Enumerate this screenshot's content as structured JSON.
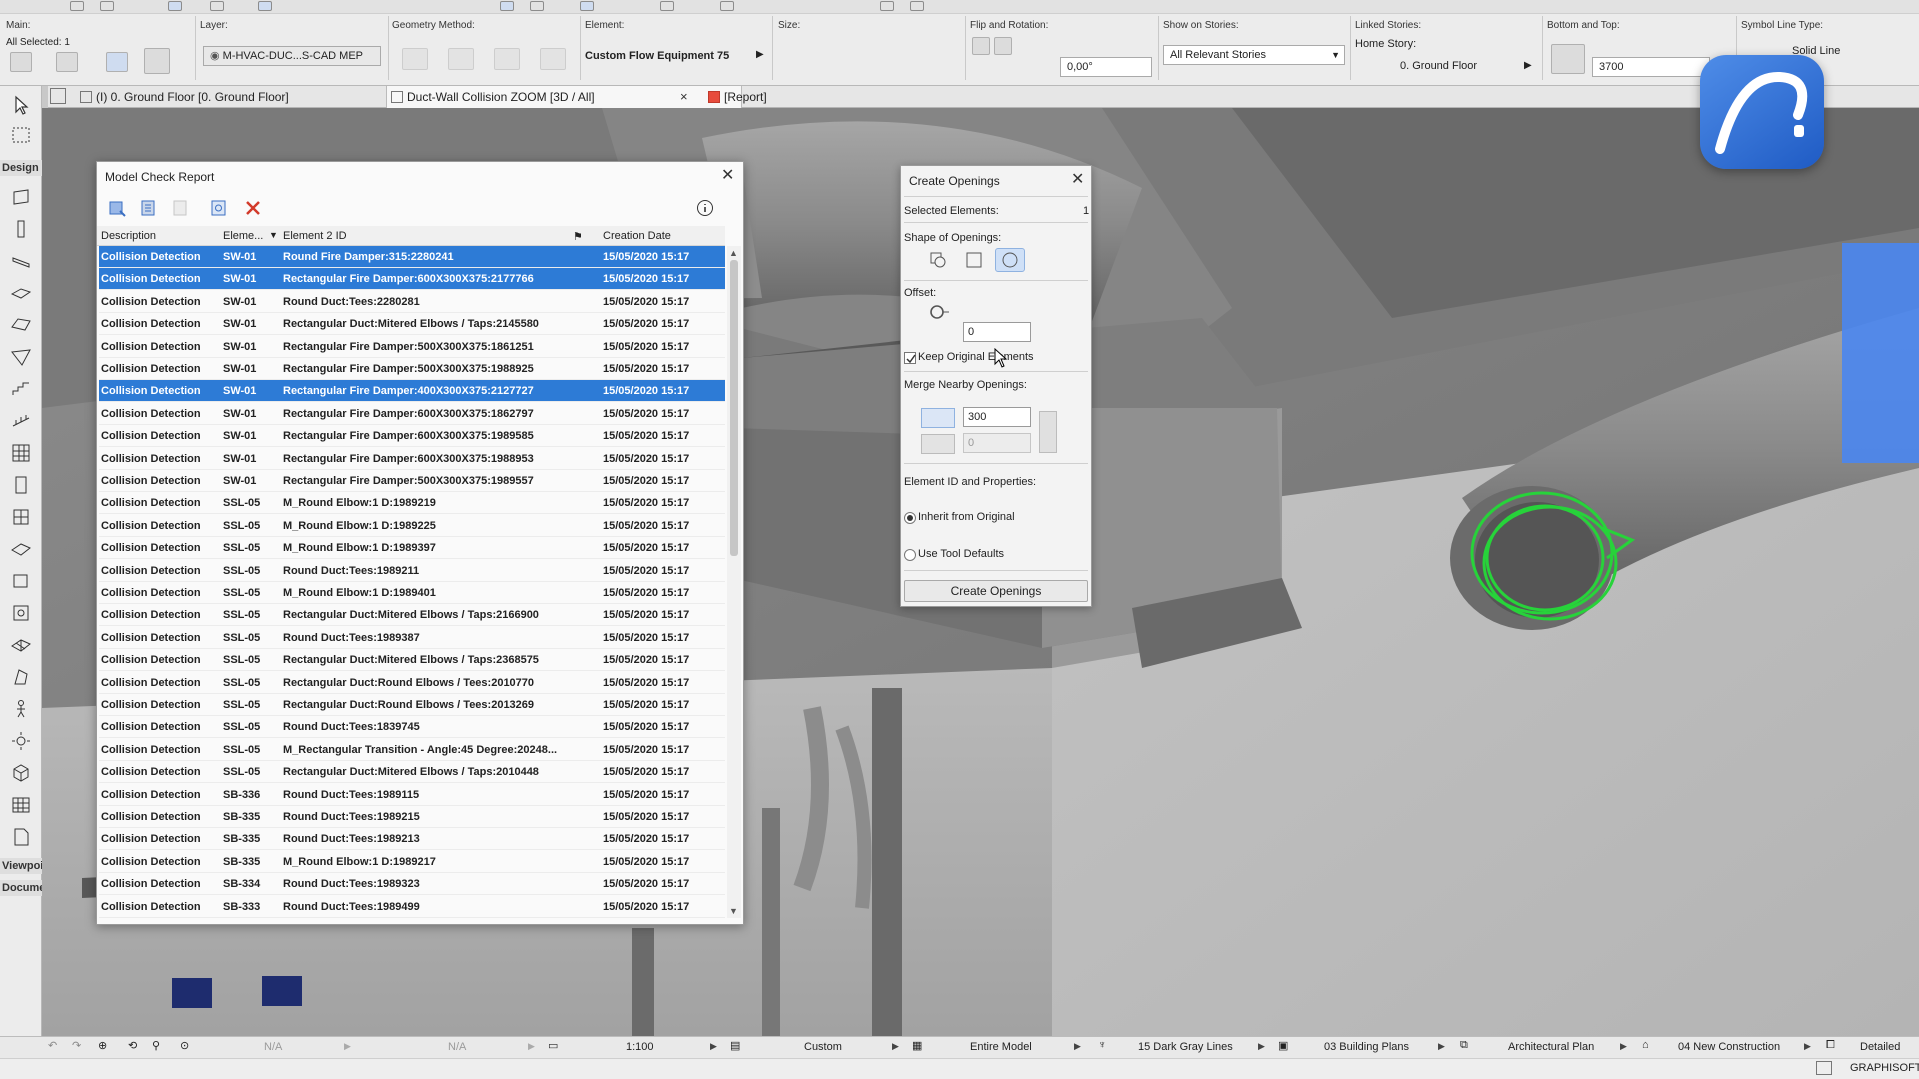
{
  "infobox": {
    "main_label": "Main:",
    "all_selected": "All Selected: 1",
    "layer_label": "Layer:",
    "layer_value": "M-HVAC-DUC...S-CAD MEP",
    "geometry_label": "Geometry Method:",
    "element_label": "Element:",
    "element_value": "Custom Flow Equipment 75",
    "size_label": "Size:",
    "flip_label": "Flip and Rotation:",
    "rotation_value": "0,00°",
    "show_on_stories_label": "Show on Stories:",
    "show_on_stories_value": "All Relevant Stories",
    "linked_stories_label": "Linked Stories:",
    "home_story_label": "Home Story:",
    "home_story_value": "0. Ground Floor",
    "bottom_top_label": "Bottom and Top:",
    "bottom_top_value": "3700",
    "symbol_line_label": "Symbol Line Type:",
    "symbol_line_value": "Solid Line"
  },
  "tabs": [
    {
      "label": "(I) 0. Ground Floor [0. Ground Floor]"
    },
    {
      "label": "Duct-Wall Collision ZOOM [3D / All]"
    },
    {
      "label": "[Report]"
    }
  ],
  "toolbox": {
    "design_label": "Design",
    "viewpoint_label": "Viewpoi",
    "document_label": "Docume"
  },
  "report": {
    "title": "Model Check Report",
    "columns": {
      "description": "Description",
      "element": "Eleme...",
      "element2": "Element 2 ID",
      "date": "Creation Date"
    },
    "rows": [
      {
        "desc": "Collision Detection",
        "el": "SW-01",
        "id2": "Round Fire Damper:315:2280241",
        "date": "15/05/2020 15:17"
      },
      {
        "desc": "Collision Detection",
        "el": "SW-01",
        "id2": "Rectangular Fire Damper:600X300X375:2177766",
        "date": "15/05/2020 15:17"
      },
      {
        "desc": "Collision Detection",
        "el": "SW-01",
        "id2": "Round Duct:Tees:2280281",
        "date": "15/05/2020 15:17"
      },
      {
        "desc": "Collision Detection",
        "el": "SW-01",
        "id2": "Rectangular Duct:Mitered Elbows / Taps:2145580",
        "date": "15/05/2020 15:17"
      },
      {
        "desc": "Collision Detection",
        "el": "SW-01",
        "id2": "Rectangular Fire Damper:500X300X375:1861251",
        "date": "15/05/2020 15:17"
      },
      {
        "desc": "Collision Detection",
        "el": "SW-01",
        "id2": "Rectangular Fire Damper:500X300X375:1988925",
        "date": "15/05/2020 15:17"
      },
      {
        "desc": "Collision Detection",
        "el": "SW-01",
        "id2": "Rectangular Fire Damper:400X300X375:2127727",
        "date": "15/05/2020 15:17"
      },
      {
        "desc": "Collision Detection",
        "el": "SW-01",
        "id2": "Rectangular Fire Damper:600X300X375:1862797",
        "date": "15/05/2020 15:17"
      },
      {
        "desc": "Collision Detection",
        "el": "SW-01",
        "id2": "Rectangular Fire Damper:600X300X375:1989585",
        "date": "15/05/2020 15:17"
      },
      {
        "desc": "Collision Detection",
        "el": "SW-01",
        "id2": "Rectangular Fire Damper:600X300X375:1988953",
        "date": "15/05/2020 15:17"
      },
      {
        "desc": "Collision Detection",
        "el": "SW-01",
        "id2": "Rectangular Fire Damper:500X300X375:1989557",
        "date": "15/05/2020 15:17"
      },
      {
        "desc": "Collision Detection",
        "el": "SSL-05",
        "id2": "M_Round Elbow:1 D:1989219",
        "date": "15/05/2020 15:17"
      },
      {
        "desc": "Collision Detection",
        "el": "SSL-05",
        "id2": "M_Round Elbow:1 D:1989225",
        "date": "15/05/2020 15:17"
      },
      {
        "desc": "Collision Detection",
        "el": "SSL-05",
        "id2": "M_Round Elbow:1 D:1989397",
        "date": "15/05/2020 15:17"
      },
      {
        "desc": "Collision Detection",
        "el": "SSL-05",
        "id2": "Round Duct:Tees:1989211",
        "date": "15/05/2020 15:17"
      },
      {
        "desc": "Collision Detection",
        "el": "SSL-05",
        "id2": "M_Round Elbow:1 D:1989401",
        "date": "15/05/2020 15:17"
      },
      {
        "desc": "Collision Detection",
        "el": "SSL-05",
        "id2": "Rectangular Duct:Mitered Elbows / Taps:2166900",
        "date": "15/05/2020 15:17"
      },
      {
        "desc": "Collision Detection",
        "el": "SSL-05",
        "id2": "Round Duct:Tees:1989387",
        "date": "15/05/2020 15:17"
      },
      {
        "desc": "Collision Detection",
        "el": "SSL-05",
        "id2": "Rectangular Duct:Mitered Elbows / Taps:2368575",
        "date": "15/05/2020 15:17"
      },
      {
        "desc": "Collision Detection",
        "el": "SSL-05",
        "id2": "Rectangular Duct:Round Elbows / Tees:2010770",
        "date": "15/05/2020 15:17"
      },
      {
        "desc": "Collision Detection",
        "el": "SSL-05",
        "id2": "Rectangular Duct:Round Elbows / Tees:2013269",
        "date": "15/05/2020 15:17"
      },
      {
        "desc": "Collision Detection",
        "el": "SSL-05",
        "id2": "Round Duct:Tees:1839745",
        "date": "15/05/2020 15:17"
      },
      {
        "desc": "Collision Detection",
        "el": "SSL-05",
        "id2": "M_Rectangular Transition - Angle:45 Degree:20248...",
        "date": "15/05/2020 15:17"
      },
      {
        "desc": "Collision Detection",
        "el": "SSL-05",
        "id2": "Rectangular Duct:Mitered Elbows / Taps:2010448",
        "date": "15/05/2020 15:17"
      },
      {
        "desc": "Collision Detection",
        "el": "SB-336",
        "id2": "Round Duct:Tees:1989115",
        "date": "15/05/2020 15:17"
      },
      {
        "desc": "Collision Detection",
        "el": "SB-335",
        "id2": "Round Duct:Tees:1989215",
        "date": "15/05/2020 15:17"
      },
      {
        "desc": "Collision Detection",
        "el": "SB-335",
        "id2": "Round Duct:Tees:1989213",
        "date": "15/05/2020 15:17"
      },
      {
        "desc": "Collision Detection",
        "el": "SB-335",
        "id2": "M_Round Elbow:1 D:1989217",
        "date": "15/05/2020 15:17"
      },
      {
        "desc": "Collision Detection",
        "el": "SB-334",
        "id2": "Round Duct:Tees:1989323",
        "date": "15/05/2020 15:17"
      },
      {
        "desc": "Collision Detection",
        "el": "SB-333",
        "id2": "Round Duct:Tees:1989499",
        "date": "15/05/2020 15:17"
      }
    ]
  },
  "create_openings": {
    "title": "Create Openings",
    "selected_label": "Selected Elements:",
    "selected_count": "1",
    "shape_label": "Shape of Openings:",
    "offset_label": "Offset:",
    "offset_value": "0",
    "keep_original_label": "Keep Original Elements",
    "merge_label": "Merge Nearby Openings:",
    "merge_value_1": "300",
    "merge_value_2": "0",
    "element_id_label": "Element ID and Properties:",
    "inherit_label": "Inherit from Original",
    "tool_defaults_label": "Use Tool Defaults",
    "button_label": "Create Openings"
  },
  "statusbar": {
    "na1": "N/A",
    "na2": "N/A",
    "scale": "1:100",
    "custom": "Custom",
    "model": "Entire Model",
    "pens": "15 Dark Gray Lines",
    "layers": "03 Building Plans",
    "view": "Architectural Plan",
    "renovation": "04 New Construction",
    "detail": "Detailed",
    "brand": "GRAPHISOFT"
  },
  "colors": {
    "selection": "#2d7bd6",
    "highlight_green": "#27d33a",
    "logo_blue": "#2f6fd8"
  }
}
